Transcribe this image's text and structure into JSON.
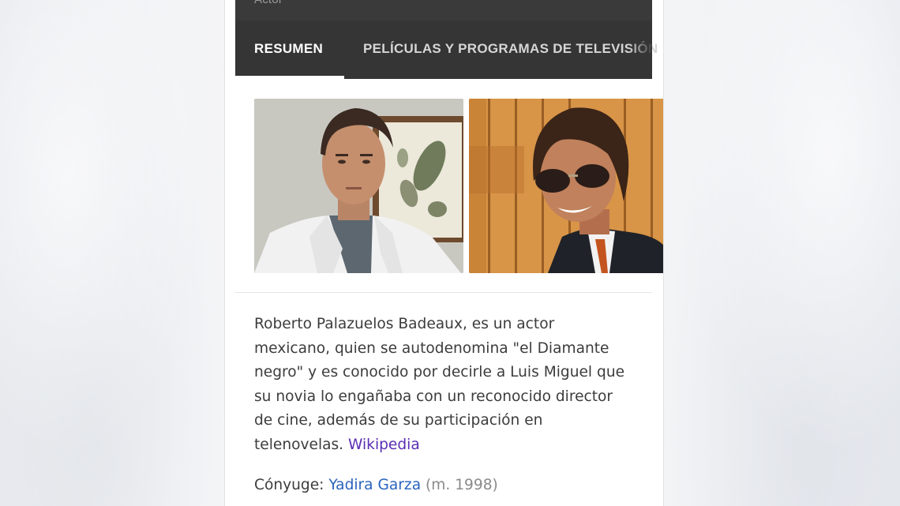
{
  "header": {
    "subtitle": "Actor"
  },
  "tabs": [
    {
      "label": "RESUMEN",
      "selected": true
    },
    {
      "label": "PELÍCULAS Y PROGRAMAS DE TELEVISIÓN",
      "selected": false
    }
  ],
  "images": [
    {
      "description_icon": "person-photo-icon"
    },
    {
      "description_icon": "person-photo-icon"
    }
  ],
  "description": {
    "lines": [
      "Roberto Palazuelos Badeaux, es un actor",
      "mexicano, quien se autodenomina \"el Diamante",
      "negro\" y es conocido por decirle a Luis Miguel que",
      "su novia lo engañaba con un reconocido director",
      "de cine, además de su participación en",
      "telenovelas."
    ],
    "source_link": "Wikipedia"
  },
  "facts": {
    "spouse_label": "Cónyuge:",
    "spouse_name": "Yadira Garza",
    "spouse_meta": "(m. 1998)"
  },
  "colors": {
    "header_bg": "#353535",
    "tab_active": "#ffffff",
    "tab_inactive": "#d6d6d6",
    "link_visited": "#5a2db4",
    "link": "#2a63bd",
    "body_text": "#3c3c3c"
  }
}
